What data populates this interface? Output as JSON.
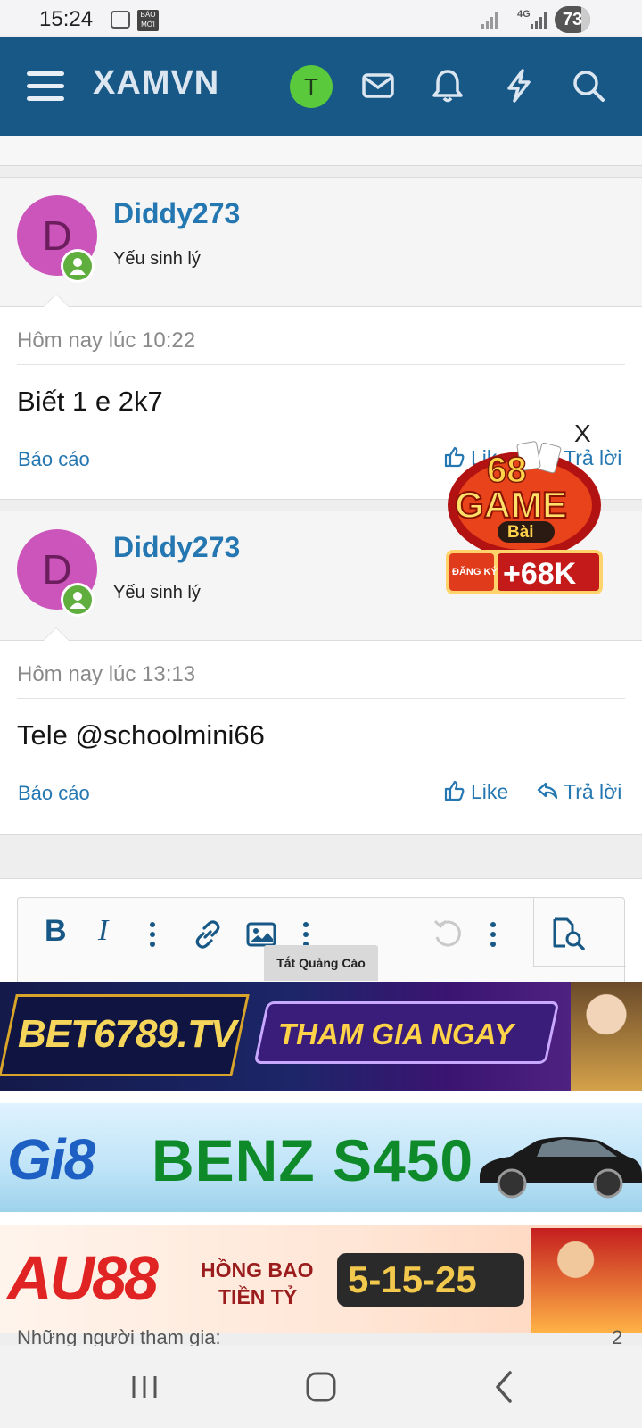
{
  "status_bar": {
    "time": "15:24",
    "news_badge": "BÁO MỚI",
    "network": "4G",
    "battery": "73"
  },
  "header": {
    "logo": "XAMVN",
    "user_initial": "T",
    "icons": [
      "menu-icon",
      "mail-icon",
      "bell-icon",
      "bolt-icon",
      "search-icon"
    ],
    "brand_color": "#185886",
    "avatar_color": "#5bc93c"
  },
  "posts": [
    {
      "avatar_letter": "D",
      "username": "Diddy273",
      "user_title": "Yếu sinh lý",
      "date": "Hôm nay lúc 10:22",
      "message": "Biết 1 e 2k7",
      "report": "Báo cáo",
      "like": "Like",
      "reply": "Trả lời"
    },
    {
      "avatar_letter": "D",
      "username": "Diddy273",
      "user_title": "Yếu sinh lý",
      "date": "Hôm nay lúc 13:13",
      "message": "Tele @schoolmini66",
      "report": "Báo cáo",
      "like": "Like",
      "reply": "Trả lời"
    }
  ],
  "editor": {
    "bold": "B",
    "italic": "I",
    "icons": [
      "bold-icon",
      "italic-icon",
      "more-icon",
      "link-icon",
      "image-icon",
      "undo-icon",
      "preview-icon"
    ]
  },
  "ads": {
    "close_label": "Tắt Quảng Cáo",
    "float_close": "X",
    "float_ad": {
      "number": "68",
      "title": "GAME",
      "subtitle": "Bài",
      "register": "ĐĂNG KÝ",
      "bonus": "+68K"
    },
    "banner1": {
      "logo": "BET6789.TV",
      "cta": "THAM GIA NGAY"
    },
    "banner2": {
      "logo": "Gi8",
      "text": "BENZ S450"
    },
    "banner3": {
      "logo": "AU88",
      "line1": "HỒNG BAO",
      "line2": "TIỀN TỶ",
      "box": "5-15-25"
    }
  },
  "footer_cutoff": {
    "label": "Những người tham gia:",
    "count": "2"
  }
}
